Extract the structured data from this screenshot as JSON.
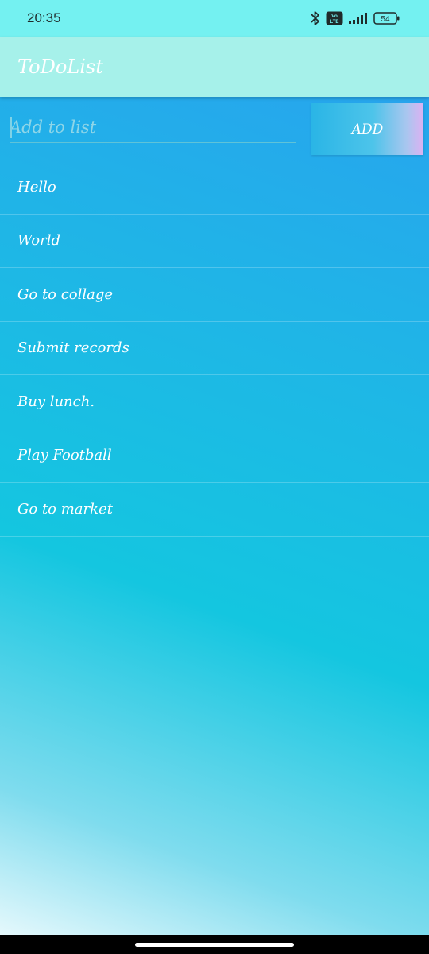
{
  "status_bar": {
    "time": "20:35",
    "volte_top": "Vo",
    "volte_bottom": "LTE",
    "battery": "54",
    "icons": [
      "bluetooth-icon",
      "volte-icon",
      "signal-icon",
      "battery-icon"
    ]
  },
  "app_bar": {
    "title": "ToDoList"
  },
  "input": {
    "placeholder": "Add to list",
    "value": ""
  },
  "add_button": {
    "label": "ADD"
  },
  "todo_items": [
    {
      "label": "Hello"
    },
    {
      "label": "World"
    },
    {
      "label": "Go to collage"
    },
    {
      "label": "Submit records"
    },
    {
      "label": "Buy lunch."
    },
    {
      "label": "Play Football"
    },
    {
      "label": "Go to market"
    }
  ],
  "colors": {
    "status_bar_bg": "#74f1f1",
    "app_bar_bg": "#a6f1ea",
    "gradient_top": "#2a9ff0",
    "gradient_mid": "#14c6e0",
    "gradient_bottom": "#f2fcfe",
    "text": "#ffffff"
  }
}
